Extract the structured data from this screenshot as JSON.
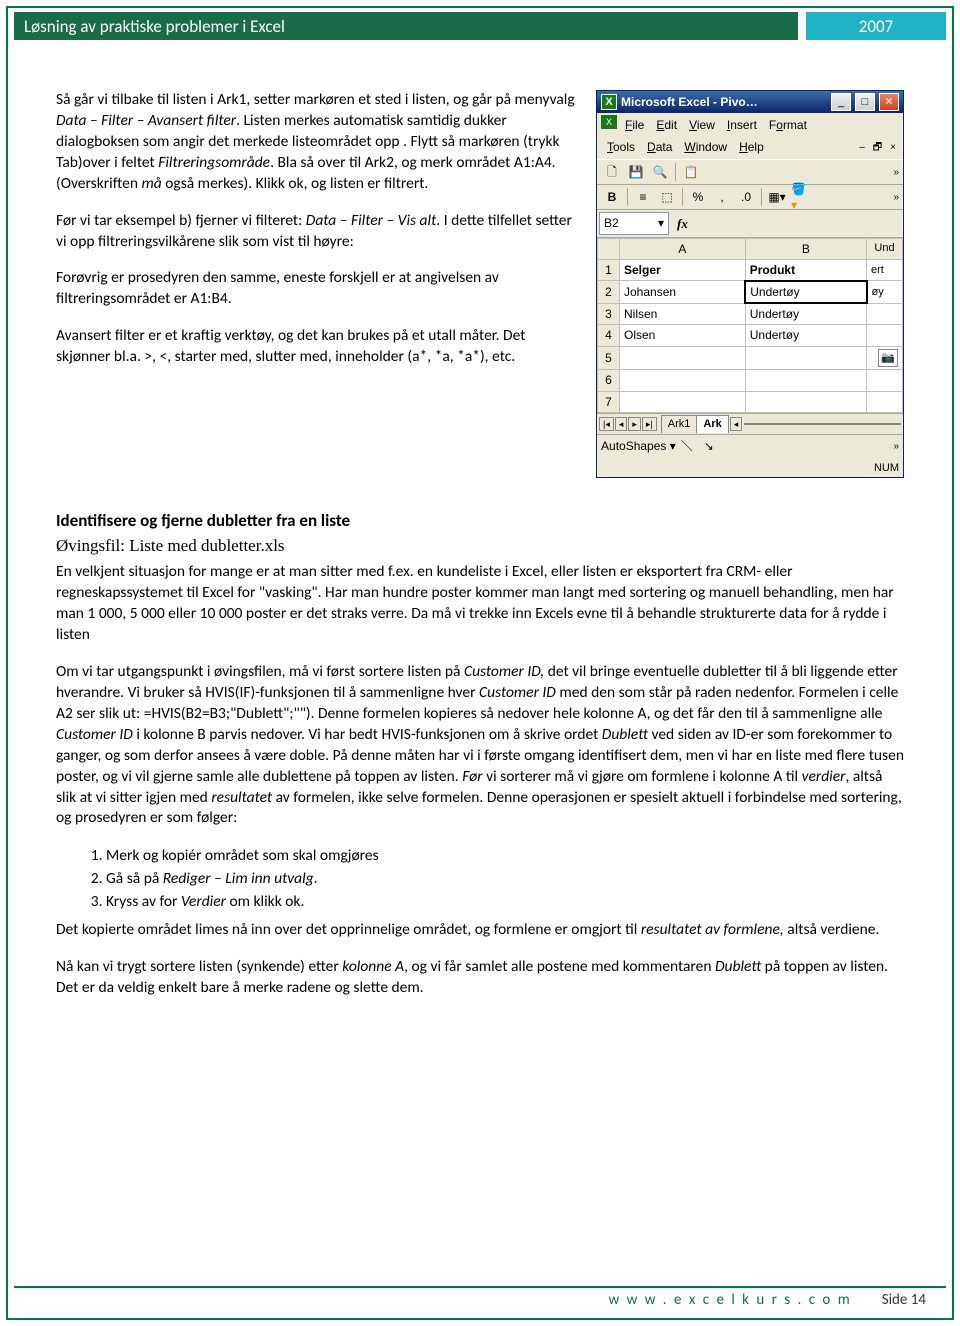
{
  "header": {
    "title": "Løsning av praktiske problemer i Excel",
    "year": "2007"
  },
  "body": {
    "p1_a": "Så går vi tilbake til listen i Ark1, setter markøren et sted i listen, og går på menyvalg ",
    "p1_b": "Data – Filter – Avansert filter",
    "p1_c": ". Listen merkes automatisk samtidig dukker dialogboksen som angir det merkede listeområdet opp . Flytt så markøren (trykk Tab)over i feltet ",
    "p1_d": "Filtreringsområde",
    "p1_e": ". Bla så over til Ark2, og merk området A1:A4. (Overskriften ",
    "p1_f": "må",
    "p1_g": " også merkes). Klikk ok, og listen er filtrert.",
    "p2_a": "Før vi tar eksempel b) fjerner vi filteret: ",
    "p2_b": "Data – Filter – Vis alt",
    "p2_c": ". I dette tilfellet setter vi opp filtreringsvilkårene slik som vist til høyre:",
    "p3": "Forøvrig er prosedyren den samme, eneste forskjell er at angivelsen av filtreringsområdet er A1:B4.",
    "p4": "Avansert filter er et kraftig verktøy, og det kan brukes på et utall måter. Det skjønner bl.a. >, <, starter med, slutter med, inneholder (a*, *a, *a*), etc.",
    "section_title": "Identifisere og fjerne dubletter fra en liste",
    "file_title": "Øvingsfil: Liste med dubletter.xls",
    "p5": "En velkjent situasjon for mange er at man sitter med f.ex. en kundeliste i Excel, eller listen er eksportert fra CRM- eller regneskapssystemet til Excel for \"vasking\". Har man hundre poster kommer man langt med sortering og manuell behandling, men har man 1 000, 5 000 eller 10 000 poster er det straks verre. Da må vi trekke inn Excels evne til å behandle strukturerte data for å rydde i listen",
    "p6_a": "Om vi tar utgangspunkt i øvingsfilen, må vi først sortere listen på ",
    "p6_b": "Customer ID,",
    "p6_c": " det vil bringe eventuelle dubletter til å bli liggende etter hverandre. Vi bruker så HVIS(IF)-funksjonen til å sammenligne hver ",
    "p6_d": "Customer ID",
    "p6_e": " med den som står på raden nedenfor. Formelen i celle A2 ser slik ut: =HVIS(B2=B3;\"Dublett\";\"\"). Denne formelen kopieres så nedover hele kolonne A, og det får den til å sammenligne alle ",
    "p6_f": "Customer ID",
    "p6_g": " i kolonne B parvis nedover. Vi har bedt HVIS-funksjonen om å skrive ordet ",
    "p6_h": "Dublett",
    "p6_i": " ved siden av ID-er som forekommer to ganger, og som derfor ansees å være doble. På denne måten har vi i første omgang identifisert dem, men vi har en liste med flere tusen poster, og vi vil gjerne samle alle dublettene på toppen av listen. ",
    "p6_j": "Før",
    "p6_k": " vi sorterer må vi gjøre om formlene i kolonne A til ",
    "p6_l": "verdier",
    "p6_m": ", altså slik at vi sitter igjen med ",
    "p6_n": "resultatet",
    "p6_o": " av formelen, ikke selve formelen. Denne operasjonen er spesielt aktuell i forbindelse med sortering, og prosedyren er som følger:",
    "list": {
      "n1": "1.",
      "i1": "Merk og kopiér området som skal omgjøres",
      "n2": "2.",
      "i2_a": "Gå så på ",
      "i2_b": "Rediger – Lim inn utvalg",
      "i2_c": ".",
      "n3": "3.",
      "i3_a": "Kryss av for ",
      "i3_b": "Verdier",
      "i3_c": " om klikk ok."
    },
    "p7_a": "Det kopierte området limes nå inn over det opprinnelige området, og formlene er omgjort til ",
    "p7_b": "resultatet av formlene,",
    "p7_c": " altså verdiene.",
    "p8_a": "Nå kan vi trygt sortere listen (synkende) etter ",
    "p8_b": "kolonne A",
    "p8_c": ", og vi får samlet alle postene med kommentaren ",
    "p8_d": "Dublett",
    "p8_e": " på toppen av listen. Det er da veldig enkelt bare å merke radene og slette dem."
  },
  "excel": {
    "title": "Microsoft Excel - Pivo…",
    "menus": {
      "file": "File",
      "edit": "Edit",
      "view": "View",
      "insert": "Insert",
      "format": "Format",
      "tools": "Tools",
      "data": "Data",
      "window": "Window",
      "help": "Help"
    },
    "namebox": "B2",
    "fx": "fx",
    "colA": "A",
    "colB": "B",
    "hdr_selger": "Selger",
    "hdr_produkt": "Produkt",
    "r2a": "Johansen",
    "r2b": "Undertøy",
    "r3a": "Nilsen",
    "r3b": "Undertøy",
    "r4a": "Olsen",
    "r4b": "Undertøy",
    "rightword": {
      "l1": "Und",
      "l2": "ert",
      "l3": "øy"
    },
    "rows": {
      "r1": "1",
      "r2": "2",
      "r3": "3",
      "r4": "4",
      "r5": "5",
      "r6": "6",
      "r7": "7"
    },
    "tab1": "Ark1",
    "tab2": "Ark",
    "autoshapes": "AutoShapes",
    "num": "NUM"
  },
  "footer": {
    "url": "w w w . e x c e l k u r s . c o m",
    "page": "Side 14"
  }
}
